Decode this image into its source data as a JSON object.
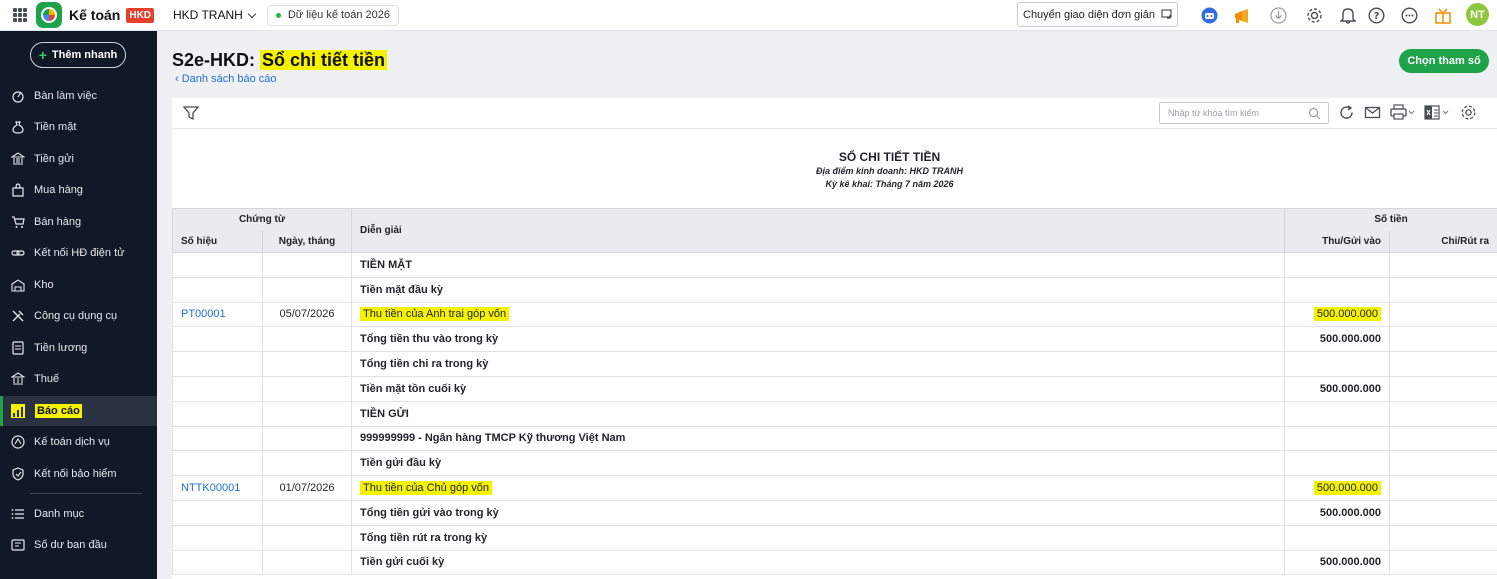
{
  "topbar": {
    "app_name": "Kế toán",
    "badge": "HKD",
    "company": "HKD TRANH",
    "data_pill": "Dữ liệu kế toán 2026",
    "switch_ui": "Chuyển giao diện đơn giản",
    "avatar": "NT"
  },
  "sidebar": {
    "quick_add": "Thêm nhanh",
    "items": [
      {
        "label": "Bàn làm việc",
        "icon": "desk-icon"
      },
      {
        "label": "Tiền mặt",
        "icon": "money-bag-icon"
      },
      {
        "label": "Tiền gửi",
        "icon": "bank-icon"
      },
      {
        "label": "Mua hàng",
        "icon": "shopping-bag-icon"
      },
      {
        "label": "Bán hàng",
        "icon": "cart-icon"
      },
      {
        "label": "Kết nối HĐ điện tử",
        "icon": "link-icon"
      },
      {
        "label": "Kho",
        "icon": "warehouse-icon"
      },
      {
        "label": "Công cụ dụng cụ",
        "icon": "tools-icon"
      },
      {
        "label": "Tiền lương",
        "icon": "payroll-icon"
      },
      {
        "label": "Thuế",
        "icon": "tax-icon"
      },
      {
        "label": "Báo cáo",
        "icon": "chart-icon"
      },
      {
        "label": "Kế toán dịch vụ",
        "icon": "service-icon"
      },
      {
        "label": "Kết nối bảo hiểm",
        "icon": "shield-icon"
      },
      {
        "label": "Danh mục",
        "icon": "list-icon"
      },
      {
        "label": "Số dư ban đầu",
        "icon": "balance-icon"
      }
    ]
  },
  "header": {
    "title_prefix": "S2e-HKD: ",
    "title_highlight": "Sổ chi tiết tiền",
    "back_link": "Danh sách báo cáo",
    "choose_button": "Chọn tham số"
  },
  "toolbar": {
    "search_placeholder": "Nhập từ khóa tìm kiếm"
  },
  "report": {
    "title": "SỔ CHI TIẾT TIỀN",
    "location": "Địa điểm kinh doanh: HKD TRANH",
    "period": "Kỳ kê khai: Tháng 7 năm 2026",
    "headers": {
      "voucher": "Chứng từ",
      "number": "Số hiệu",
      "date": "Ngày, tháng",
      "description": "Diễn giải",
      "amount": "Số tiền",
      "in": "Thu/Gửi vào",
      "out": "Chi/Rút ra"
    },
    "rows": [
      {
        "doc": "",
        "date": "",
        "desc": "TIỀN MẶT",
        "in": "",
        "out": "",
        "bold": true,
        "hl": false
      },
      {
        "doc": "",
        "date": "",
        "desc": "Tiền mặt đầu kỳ",
        "in": "",
        "out": "",
        "bold": true,
        "hl": false
      },
      {
        "doc": "PT00001",
        "date": "05/07/2026",
        "desc": "Thu tiền của Anh trai góp vốn",
        "in": "500.000.000",
        "out": "",
        "bold": false,
        "hl": true
      },
      {
        "doc": "",
        "date": "",
        "desc": "Tổng tiền thu vào trong kỳ",
        "in": "500.000.000",
        "out": "",
        "bold": true,
        "hl": false
      },
      {
        "doc": "",
        "date": "",
        "desc": "Tổng tiền chi ra trong kỳ",
        "in": "",
        "out": "",
        "bold": true,
        "hl": false
      },
      {
        "doc": "",
        "date": "",
        "desc": "Tiền mặt tồn cuối kỳ",
        "in": "500.000.000",
        "out": "",
        "bold": true,
        "hl": false
      },
      {
        "doc": "",
        "date": "",
        "desc": "TIỀN GỬI",
        "in": "",
        "out": "",
        "bold": true,
        "hl": false
      },
      {
        "doc": "",
        "date": "",
        "desc": "999999999 - Ngân hàng TMCP Kỹ thương Việt Nam",
        "in": "",
        "out": "",
        "bold": true,
        "hl": false
      },
      {
        "doc": "",
        "date": "",
        "desc": "Tiền gửi đầu kỳ",
        "in": "",
        "out": "",
        "bold": true,
        "hl": false
      },
      {
        "doc": "NTTK00001",
        "date": "01/07/2026",
        "desc": "Thu tiền của Chủ góp vốn",
        "in": "500.000.000",
        "out": "",
        "bold": false,
        "hl": true
      },
      {
        "doc": "",
        "date": "",
        "desc": "Tổng tiền gửi vào trong kỳ",
        "in": "500.000.000",
        "out": "",
        "bold": true,
        "hl": false
      },
      {
        "doc": "",
        "date": "",
        "desc": "Tổng tiền rút ra trong kỳ",
        "in": "",
        "out": "",
        "bold": true,
        "hl": false
      },
      {
        "doc": "",
        "date": "",
        "desc": "Tiền gửi cuối kỳ",
        "in": "500.000.000",
        "out": "",
        "bold": true,
        "hl": false
      }
    ]
  },
  "colors": {
    "brand_green": "#1fa34a",
    "sidebar_bg": "#111827",
    "highlight": "#f5f200",
    "link_blue": "#1f6fd1"
  }
}
